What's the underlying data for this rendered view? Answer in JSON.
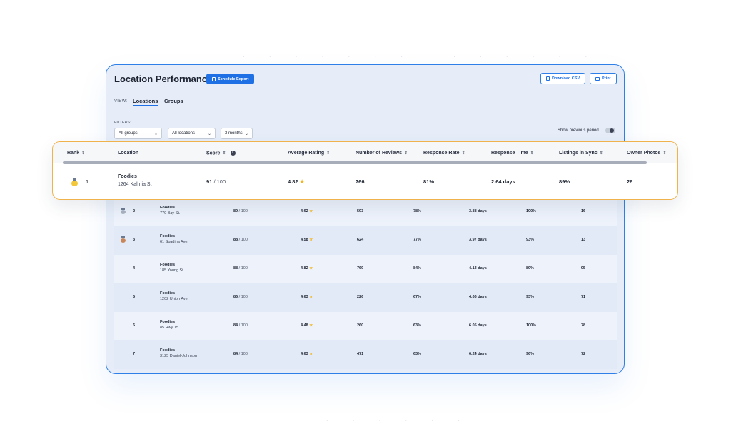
{
  "header": {
    "title": "Location Performance",
    "schedule_export": "Schedule Export",
    "download_csv": "Download CSV",
    "print": "Print"
  },
  "view": {
    "label": "VIEW:",
    "tabs": [
      "Locations",
      "Groups"
    ],
    "active_tab": "Locations"
  },
  "filters": {
    "label": "FILTERS:",
    "group": "All groups",
    "location": "All locations",
    "period": "3 months",
    "show_previous_period": "Show previous period",
    "show_previous_period_on": false
  },
  "columns": [
    "Rank",
    "Location",
    "Score",
    "Average Rating",
    "Number of Reviews",
    "Response Rate",
    "Response Time",
    "Listings in Sync",
    "Owner Photos"
  ],
  "highlighted_row": {
    "rank": "1",
    "medal": "gold",
    "name": "Foodies",
    "address": "1264 Kalmia St",
    "score": "91",
    "score_max": "/ 100",
    "rating": "4.82",
    "reviews": "766",
    "response_rate": "81%",
    "response_time": "2.64 days",
    "listings_in_sync": "89%",
    "owner_photos": "26"
  },
  "rows": [
    {
      "rank": "2",
      "medal": "silver",
      "name": "Foodies",
      "address": "770 Bay St.",
      "score": "89",
      "score_max": "/ 100",
      "rating": "4.62",
      "reviews": "593",
      "response_rate": "78%",
      "response_time": "3.88 days",
      "listings_in_sync": "100%",
      "owner_photos": "16"
    },
    {
      "rank": "3",
      "medal": "bronze",
      "name": "Foodies",
      "address": "61 Spadina Ave.",
      "score": "88",
      "score_max": "/ 100",
      "rating": "4.58",
      "reviews": "624",
      "response_rate": "77%",
      "response_time": "3.97 days",
      "listings_in_sync": "93%",
      "owner_photos": "13"
    },
    {
      "rank": "4",
      "medal": "",
      "name": "Foodies",
      "address": "185 Young St",
      "score": "88",
      "score_max": "/ 100",
      "rating": "4.82",
      "reviews": "769",
      "response_rate": "84%",
      "response_time": "4.13 days",
      "listings_in_sync": "89%",
      "owner_photos": "95"
    },
    {
      "rank": "5",
      "medal": "",
      "name": "Foodies",
      "address": "1202 Union Ave",
      "score": "86",
      "score_max": "/ 100",
      "rating": "4.63",
      "reviews": "226",
      "response_rate": "67%",
      "response_time": "4.66 days",
      "listings_in_sync": "93%",
      "owner_photos": "71"
    },
    {
      "rank": "6",
      "medal": "",
      "name": "Foodies",
      "address": "85 Hwy 15",
      "score": "84",
      "score_max": "/ 100",
      "rating": "4.48",
      "reviews": "260",
      "response_rate": "63%",
      "response_time": "6.05 days",
      "listings_in_sync": "100%",
      "owner_photos": "78"
    },
    {
      "rank": "7",
      "medal": "",
      "name": "Foodies",
      "address": "3125 Daniel-Johnson",
      "score": "84",
      "score_max": "/ 100",
      "rating": "4.63",
      "reviews": "471",
      "response_rate": "63%",
      "response_time": "6.24 days",
      "listings_in_sync": "96%",
      "owner_photos": "72"
    }
  ],
  "icons": {
    "star": "★",
    "sort": "⇕",
    "chevron": "⌄"
  },
  "colors": {
    "accent": "#1f6fe5",
    "highlight_border": "#f0b24a",
    "star": "#f3b51b",
    "gold": "#f3c73a",
    "silver": "#a9b2c0",
    "bronze": "#c8865a"
  }
}
